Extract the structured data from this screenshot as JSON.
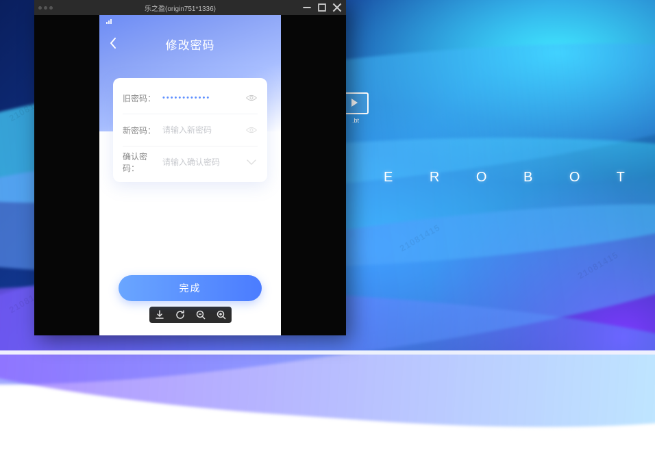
{
  "desktop": {
    "brand_text": "E R O B O T",
    "icon_label": ".bt"
  },
  "emulator": {
    "window_title": "乐之盈(origin751*1336)"
  },
  "app": {
    "page_title": "修改密码",
    "form": {
      "old_label": "旧密码：",
      "old_value_masked": "••••••••••••",
      "new_label": "新密码：",
      "new_placeholder": "请输入新密码",
      "confirm_label": "确认密码：",
      "confirm_placeholder": "请输入确认密码"
    },
    "submit_label": "完成"
  },
  "watermark": "21081415"
}
